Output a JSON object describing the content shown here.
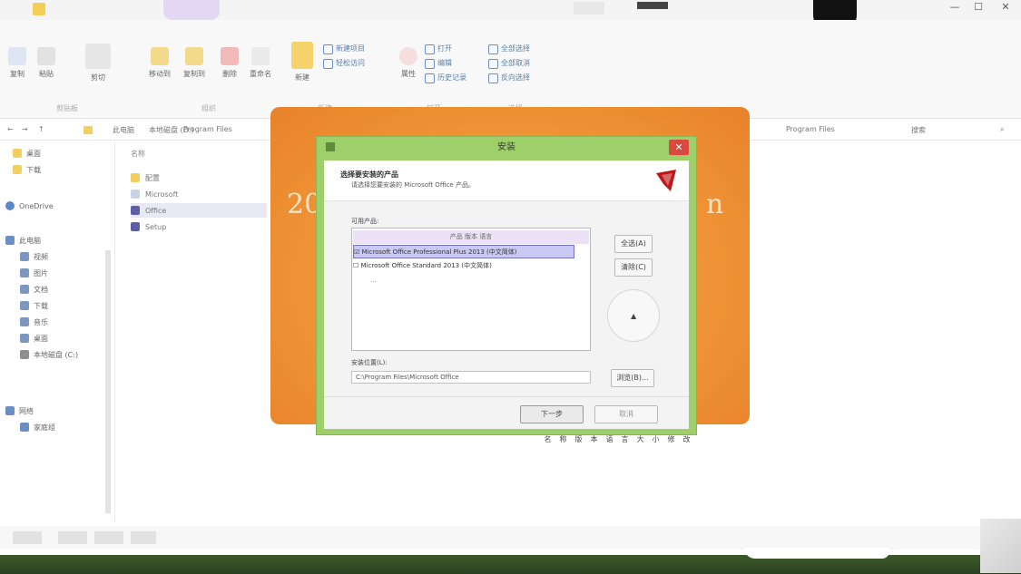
{
  "window": {
    "minimize": "—",
    "maximize": "☐",
    "close": "✕"
  },
  "ribbon": {
    "buttons": [
      {
        "label": "复制",
        "icon": "copy-icon"
      },
      {
        "label": "粘贴",
        "icon": "paste-icon"
      },
      {
        "label": "剪切",
        "icon": "cut-icon"
      },
      {
        "label": "移动到",
        "icon": "move-to-icon"
      },
      {
        "label": "复制到",
        "icon": "copy-to-icon"
      },
      {
        "label": "删除",
        "icon": "delete-icon"
      },
      {
        "label": "重命名",
        "icon": "rename-icon"
      },
      {
        "label": "新建",
        "icon": "new-folder-icon"
      },
      {
        "label": "属性",
        "icon": "properties-icon"
      }
    ],
    "small_items": [
      "新建项目",
      "轻松访问",
      "打开",
      "编辑",
      "历史记录",
      "全部选择",
      "全部取消",
      "反向选择"
    ],
    "group_labels": [
      "剪贴板",
      "组织",
      "新建",
      "打开",
      "选择"
    ]
  },
  "address": {
    "crumbs": [
      "此电脑",
      "本地磁盘 (D:)",
      "Program Files"
    ],
    "search_placeholder": "搜索"
  },
  "nav": {
    "items": [
      {
        "label": "桌面",
        "icon": "folder-icon"
      },
      {
        "label": "下载",
        "icon": "folder-icon"
      },
      {
        "label": "OneDrive",
        "icon": "cloud-icon"
      },
      {
        "label": "此电脑",
        "icon": "computer-icon"
      },
      {
        "label": "视频",
        "icon": "folder-icon"
      },
      {
        "label": "图片",
        "icon": "folder-icon"
      },
      {
        "label": "文档",
        "icon": "folder-icon"
      },
      {
        "label": "下载",
        "icon": "folder-icon"
      },
      {
        "label": "音乐",
        "icon": "folder-icon"
      },
      {
        "label": "桌面",
        "icon": "folder-icon"
      },
      {
        "label": "本地磁盘 (C:)",
        "icon": "drive-icon"
      },
      {
        "label": "网络",
        "icon": "network-icon"
      },
      {
        "label": "家庭组",
        "icon": "homegroup-icon"
      }
    ]
  },
  "files": {
    "header": "名称",
    "items": [
      "配置",
      "Microsoft",
      "Office",
      "Setup"
    ]
  },
  "splash": {
    "left_text": "20",
    "right_text": "n"
  },
  "dialog": {
    "title": "安装",
    "close": "✕",
    "header_title": "选择要安装的产品",
    "header_subtitle": "请选择您要安装的 Microsoft Office 产品。",
    "list_label": "可用产品:",
    "list_header": "产品  版本  语言",
    "list_items": [
      "Microsoft Office Professional Plus 2013 (中文简体)",
      "Microsoft Office Standard 2013 (中文简体)",
      "..."
    ],
    "side_buttons": [
      "全选(A)",
      "清除(C)"
    ],
    "path_label": "安装位置(L):",
    "path_value": "C:\\Program Files\\Microsoft Office",
    "browse_button": "浏览(B)...",
    "install_button": "下一步",
    "cancel_button": "取消"
  },
  "below_dialog": {
    "columns": [
      "名",
      "称",
      "版",
      "本",
      "语",
      "言",
      "大",
      "小",
      "修",
      "改"
    ]
  },
  "colors": {
    "splash": "#f09a3a",
    "dialog_frame": "#9fcf6a",
    "selection": "#c9c9f3",
    "close_red": "#d9493f"
  }
}
